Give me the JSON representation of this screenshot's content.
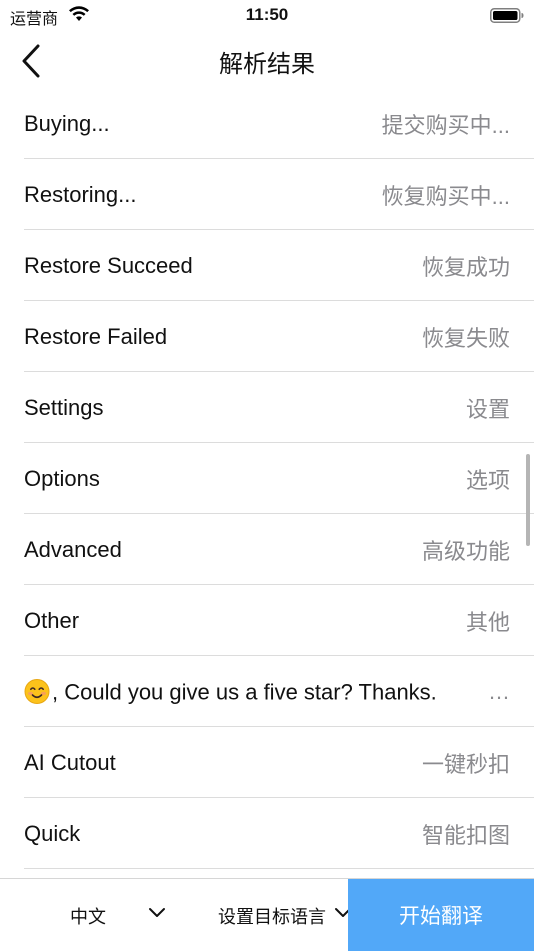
{
  "status_bar": {
    "carrier": "运营商",
    "time": "11:50"
  },
  "nav": {
    "title": "解析结果",
    "back_icon": "chevron-left-icon"
  },
  "rows": [
    {
      "key": "Buying...",
      "value": "提交购买中..."
    },
    {
      "key": "Restoring...",
      "value": "恢复购买中..."
    },
    {
      "key": "Restore Succeed",
      "value": "恢复成功"
    },
    {
      "key": "Restore Failed",
      "value": "恢复失败"
    },
    {
      "key": "Settings",
      "value": "设置"
    },
    {
      "key": "Options",
      "value": "选项"
    },
    {
      "key": "Advanced",
      "value": "高级功能"
    },
    {
      "key": "Other",
      "value": "其他"
    },
    {
      "key": ", Could you give us a five star? Thanks.",
      "value": "…",
      "emoji": "smiling-face-icon"
    },
    {
      "key": "AI Cutout",
      "value": "一键秒扣"
    },
    {
      "key": "Quick",
      "value": "智能扣图"
    }
  ],
  "bottom_bar": {
    "source_language": "中文",
    "target_language": "设置目标语言",
    "translate_button": "开始翻译"
  },
  "colors": {
    "accent": "#52a8f8",
    "value_text": "#8a8a8e",
    "separator": "#dcdcdc"
  }
}
